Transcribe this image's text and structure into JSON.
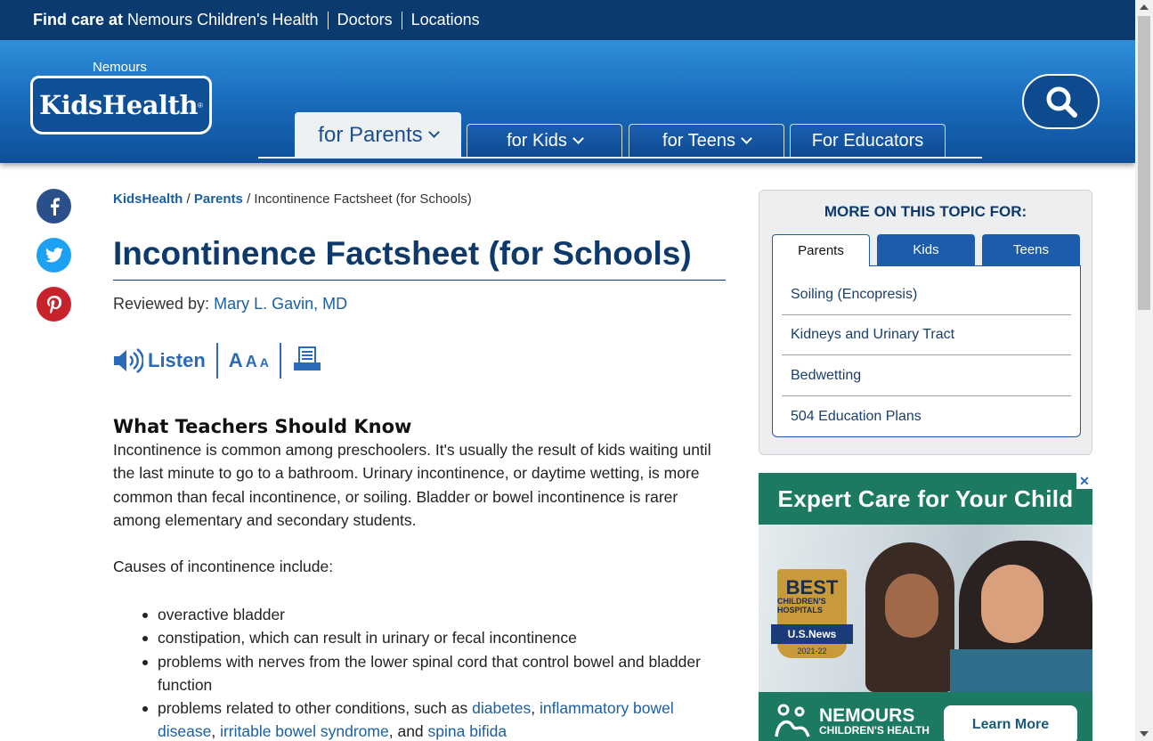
{
  "topbar": {
    "find_care_bold": "Find care at",
    "find_care_link": "Nemours Children's Health",
    "doctors": "Doctors",
    "locations": "Locations"
  },
  "logo": {
    "parent_brand": "Nemours",
    "brand": "KidsHealth"
  },
  "nav": {
    "tabs": [
      {
        "label": "for Parents",
        "active": true
      },
      {
        "label": "for Kids",
        "active": false
      },
      {
        "label": "for Teens",
        "active": false
      },
      {
        "label": "For Educators",
        "active": false
      }
    ]
  },
  "social": [
    "facebook-icon",
    "twitter-icon",
    "pinterest-icon"
  ],
  "breadcrumb": {
    "home": "KidsHealth",
    "section": "Parents",
    "current": "Incontinence Factsheet (for Schools)",
    "sep": "/"
  },
  "article": {
    "title": "Incontinence Factsheet (for Schools)",
    "reviewed_label": "Reviewed by:",
    "reviewer": "Mary L. Gavin, MD",
    "listen_label": "Listen",
    "heading": "What Teachers Should Know",
    "intro": "Incontinence is common among preschoolers. It's usually the result of kids waiting until the last minute to go to a bathroom. Urinary incontinence, or daytime wetting, is more common than fecal incontinence, or soiling. Bladder or bowel incontinence is rarer among elementary and secondary students.",
    "causes_intro": "Causes of incontinence include:",
    "causes": [
      "overactive bladder",
      "constipation, which can result in urinary or fecal incontinence",
      "problems with nerves from the lower spinal cord that control bowel and bladder function"
    ],
    "related_prefix": "problems related to other conditions, such as",
    "related_links": [
      "diabetes",
      "inflammatory bowel disease",
      "irritable bowel syndrome",
      "spina bifida"
    ],
    "related_and": "and"
  },
  "sidebar": {
    "heading": "MORE ON THIS TOPIC FOR:",
    "tabs": [
      "Parents",
      "Kids",
      "Teens"
    ],
    "items": [
      "Soiling (Encopresis)",
      "Kidneys and Urinary Tract",
      "Bedwetting",
      "504 Education Plans"
    ]
  },
  "ad": {
    "title": "Expert Care for Your Child",
    "medal_best": "BEST",
    "medal_line": "CHILDREN'S HOSPITALS",
    "medal_source": "U.S.News",
    "medal_years": "2021-22",
    "brand": "NEMOURS",
    "brand_sub": "CHILDREN'S HEALTH",
    "cta": "Learn More",
    "close": "✕"
  },
  "colors": {
    "topbar": "#0b3a6e",
    "header": "#1b6fc0",
    "title": "#0d3a6b",
    "link": "#1a5fa3",
    "ad_green": "#1c7a62"
  }
}
